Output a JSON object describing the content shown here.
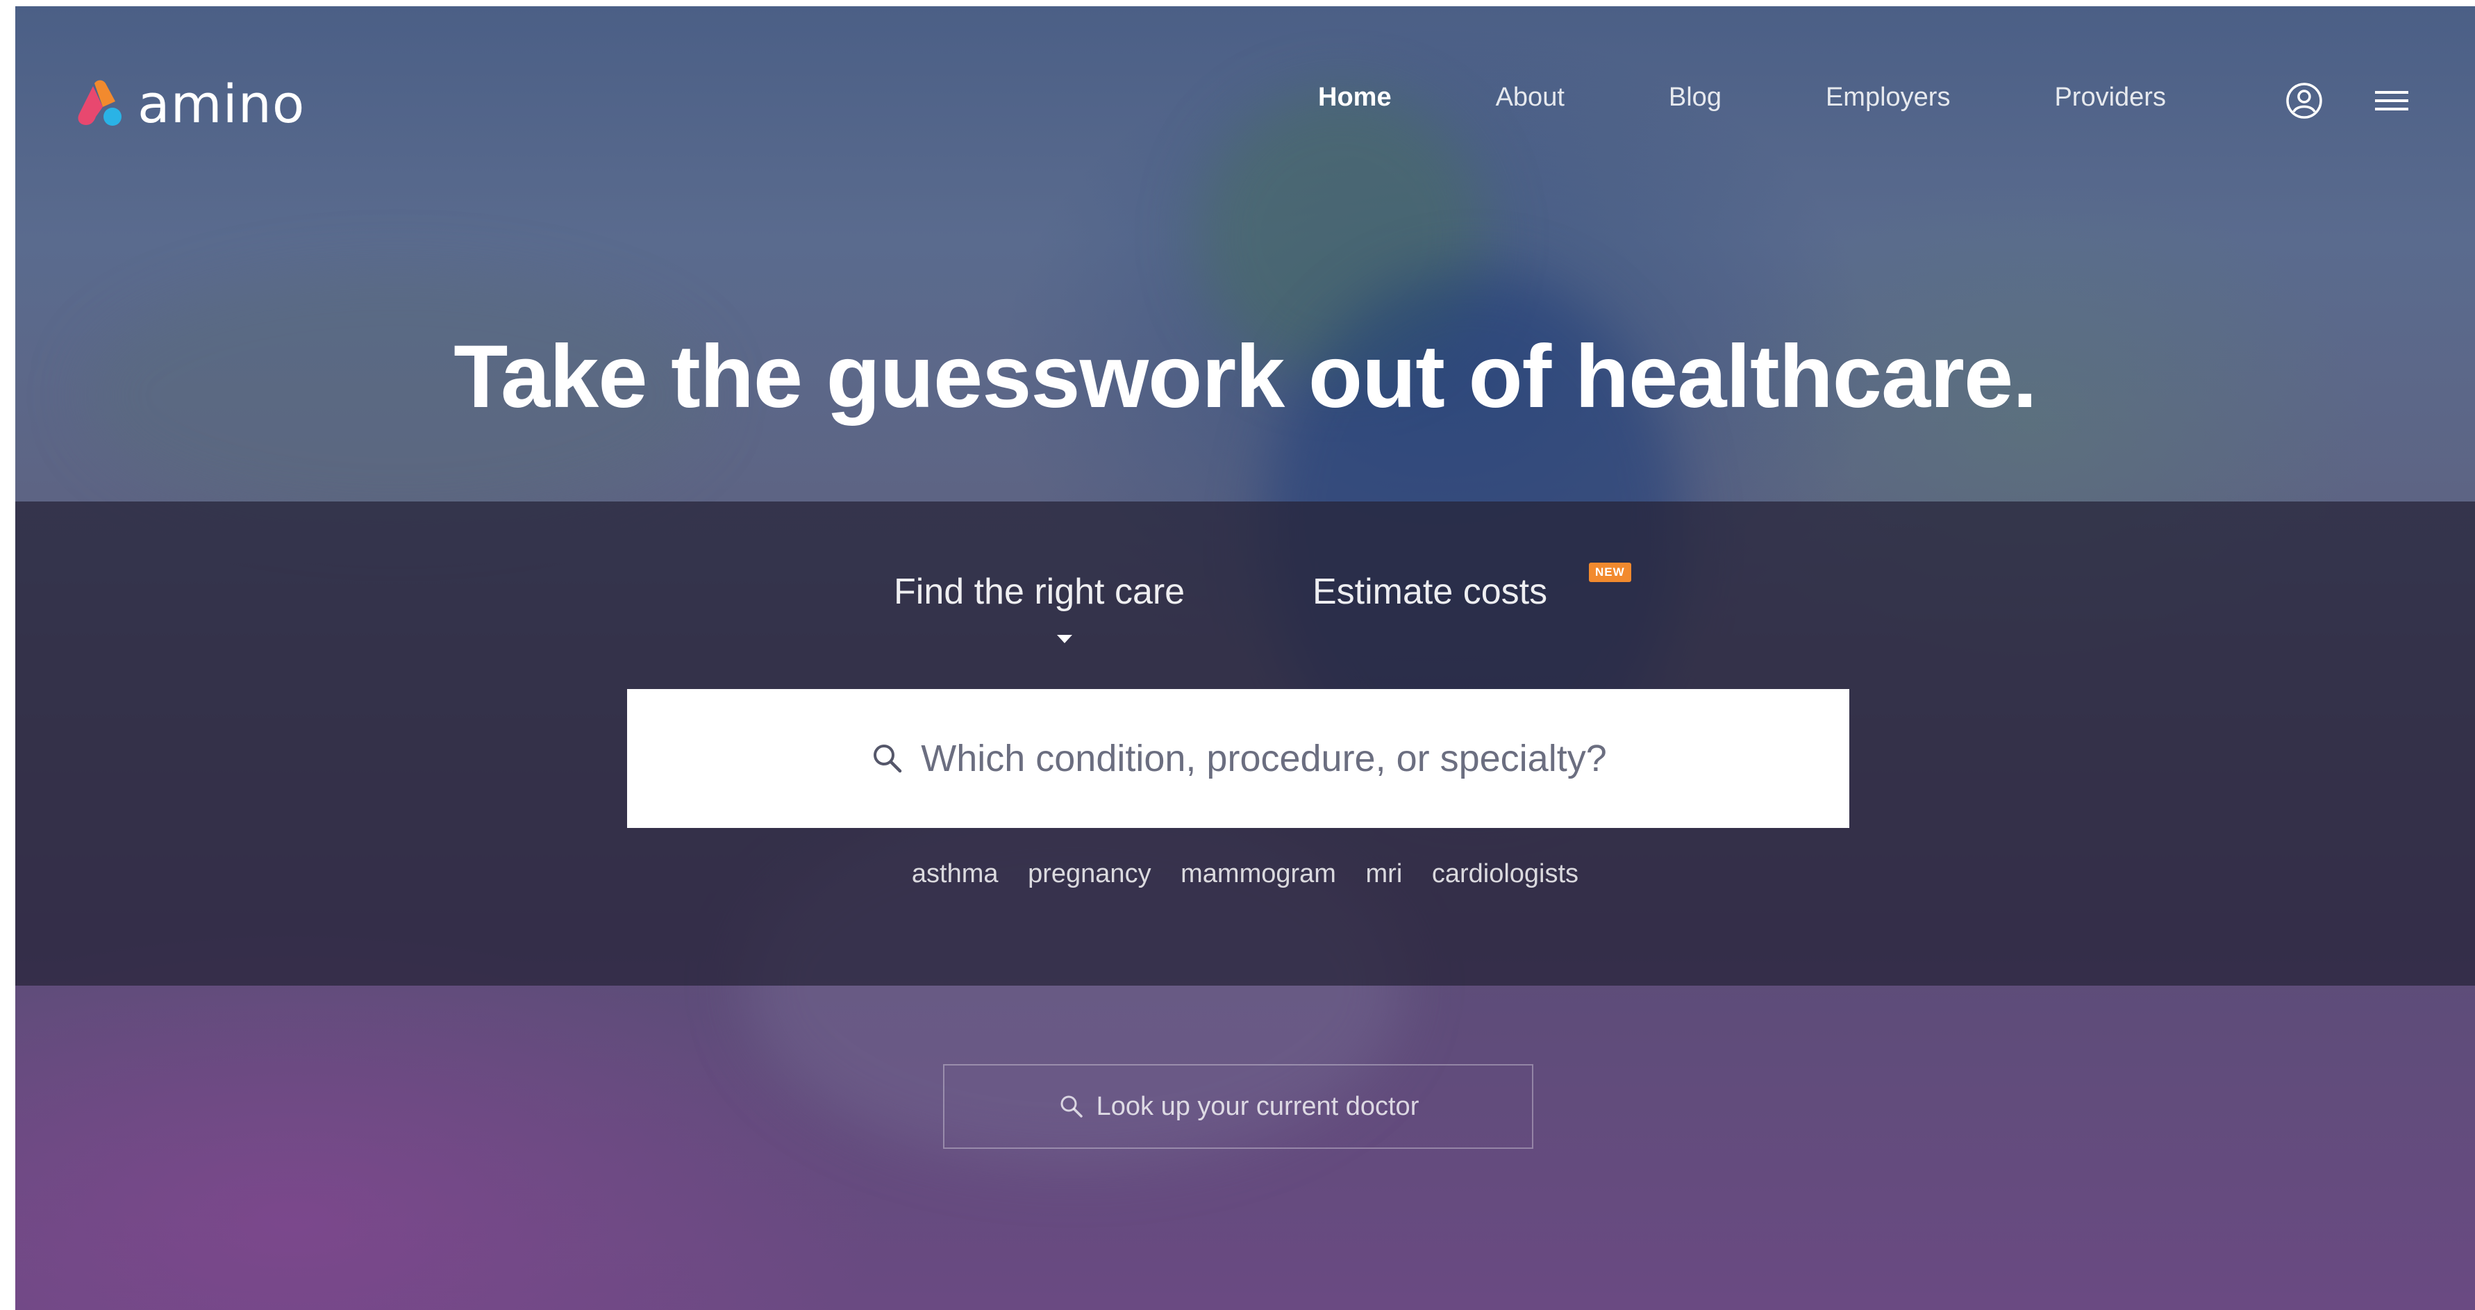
{
  "brand": {
    "name": "amino",
    "colors": {
      "orange": "#f28a2e",
      "pink": "#e8486f",
      "blue": "#2ab3e6"
    }
  },
  "nav": {
    "items": [
      {
        "label": "Home",
        "active": true
      },
      {
        "label": "About",
        "active": false
      },
      {
        "label": "Blog",
        "active": false
      },
      {
        "label": "Employers",
        "active": false
      },
      {
        "label": "Providers",
        "active": false
      }
    ],
    "icons": [
      "account-icon",
      "menu-icon"
    ]
  },
  "hero": {
    "headline": "Take the guesswork out of healthcare."
  },
  "tabs": {
    "find": "Find the right care",
    "estimate": "Estimate costs",
    "estimate_badge": "NEW",
    "selected": "find"
  },
  "search": {
    "placeholder": "Which condition, procedure, or specialty?",
    "icon": "search-icon"
  },
  "suggestions": [
    "asthma",
    "pregnancy",
    "mammogram",
    "mri",
    "cardiologists"
  ],
  "doctor_lookup": {
    "label": "Look up your current doctor",
    "icon": "search-icon"
  }
}
